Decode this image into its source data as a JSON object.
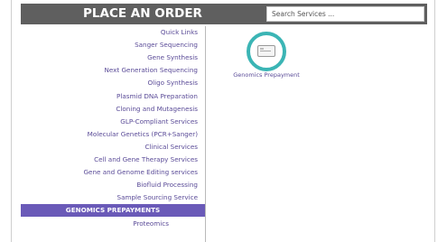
{
  "header": {
    "title": "PLACE AN ORDER",
    "search_placeholder": "Search Services ..."
  },
  "sidebar": {
    "items": [
      {
        "label": "Quick Links"
      },
      {
        "label": "Sanger Sequencing"
      },
      {
        "label": "Gene Synthesis"
      },
      {
        "label": "Next Generation Sequencing"
      },
      {
        "label": "Oligo Synthesis"
      },
      {
        "label": "Plasmid DNA Preparation"
      },
      {
        "label": "Cloning and Mutagenesis"
      },
      {
        "label": "GLP-Compliant Services"
      },
      {
        "label": "Molecular Genetics (PCR+Sanger)"
      },
      {
        "label": "Clinical Services"
      },
      {
        "label": "Cell and Gene Therapy Services"
      },
      {
        "label": "Gene and Genome Editing services"
      },
      {
        "label": "Biofluid Processing"
      },
      {
        "label": "Sample Sourcing Service"
      },
      {
        "label": "GENOMICS PREPAYMENTS"
      },
      {
        "label": "Proteomics"
      }
    ],
    "active_label": "GENOMICS PREPAYMENTS"
  },
  "content": {
    "product": {
      "label": "Genomics Prepayment",
      "icon": "credit-card-icon"
    }
  },
  "colors": {
    "header_bg": "#5f5f5f",
    "link": "#5b4c98",
    "active_bg": "#6a5ab8",
    "highlight_ring": "#3bb5b5"
  }
}
